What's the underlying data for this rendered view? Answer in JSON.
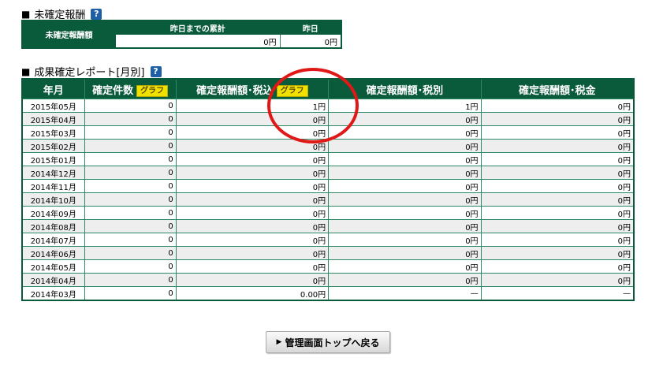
{
  "pending": {
    "title": "未確定報酬",
    "help_icon": "?",
    "row_label": "未確定報酬額",
    "col_cumulative": "昨日までの累計",
    "col_yesterday": "昨日",
    "val_cumulative": "0円",
    "val_yesterday": "0円"
  },
  "report": {
    "title": "成果確定レポート[月別]",
    "help_icon": "?",
    "headers": {
      "month": "年月",
      "count": "確定件数",
      "reward_incl": "確定報酬額･税込",
      "reward_excl": "確定報酬額･税別",
      "tax": "確定報酬額･税金"
    },
    "graph_label": "グラフ",
    "rows": [
      {
        "month": "2015年05月",
        "count": "0",
        "incl": "1円",
        "excl": "1円",
        "tax": "0円"
      },
      {
        "month": "2015年04月",
        "count": "0",
        "incl": "0円",
        "excl": "0円",
        "tax": "0円"
      },
      {
        "month": "2015年03月",
        "count": "0",
        "incl": "0円",
        "excl": "0円",
        "tax": "0円"
      },
      {
        "month": "2015年02月",
        "count": "0",
        "incl": "0円",
        "excl": "0円",
        "tax": "0円"
      },
      {
        "month": "2015年01月",
        "count": "0",
        "incl": "0円",
        "excl": "0円",
        "tax": "0円"
      },
      {
        "month": "2014年12月",
        "count": "0",
        "incl": "0円",
        "excl": "0円",
        "tax": "0円"
      },
      {
        "month": "2014年11月",
        "count": "0",
        "incl": "0円",
        "excl": "0円",
        "tax": "0円"
      },
      {
        "month": "2014年10月",
        "count": "0",
        "incl": "0円",
        "excl": "0円",
        "tax": "0円"
      },
      {
        "month": "2014年09月",
        "count": "0",
        "incl": "0円",
        "excl": "0円",
        "tax": "0円"
      },
      {
        "month": "2014年08月",
        "count": "0",
        "incl": "0円",
        "excl": "0円",
        "tax": "0円"
      },
      {
        "month": "2014年07月",
        "count": "0",
        "incl": "0円",
        "excl": "0円",
        "tax": "0円"
      },
      {
        "month": "2014年06月",
        "count": "0",
        "incl": "0円",
        "excl": "0円",
        "tax": "0円"
      },
      {
        "month": "2014年05月",
        "count": "0",
        "incl": "0円",
        "excl": "0円",
        "tax": "0円"
      },
      {
        "month": "2014年04月",
        "count": "0",
        "incl": "0円",
        "excl": "0円",
        "tax": "0円"
      },
      {
        "month": "2014年03月",
        "count": "0",
        "incl": "0.00円",
        "excl": "—",
        "tax": "—"
      }
    ]
  },
  "back_button": {
    "label": "管理画面トップへ戻る",
    "icon": "▶"
  },
  "colors": {
    "header_green": "#0a5a3c",
    "border_green": "#2b8a63",
    "graph_yellow": "#f1e100",
    "annotation_red": "#e01818"
  }
}
